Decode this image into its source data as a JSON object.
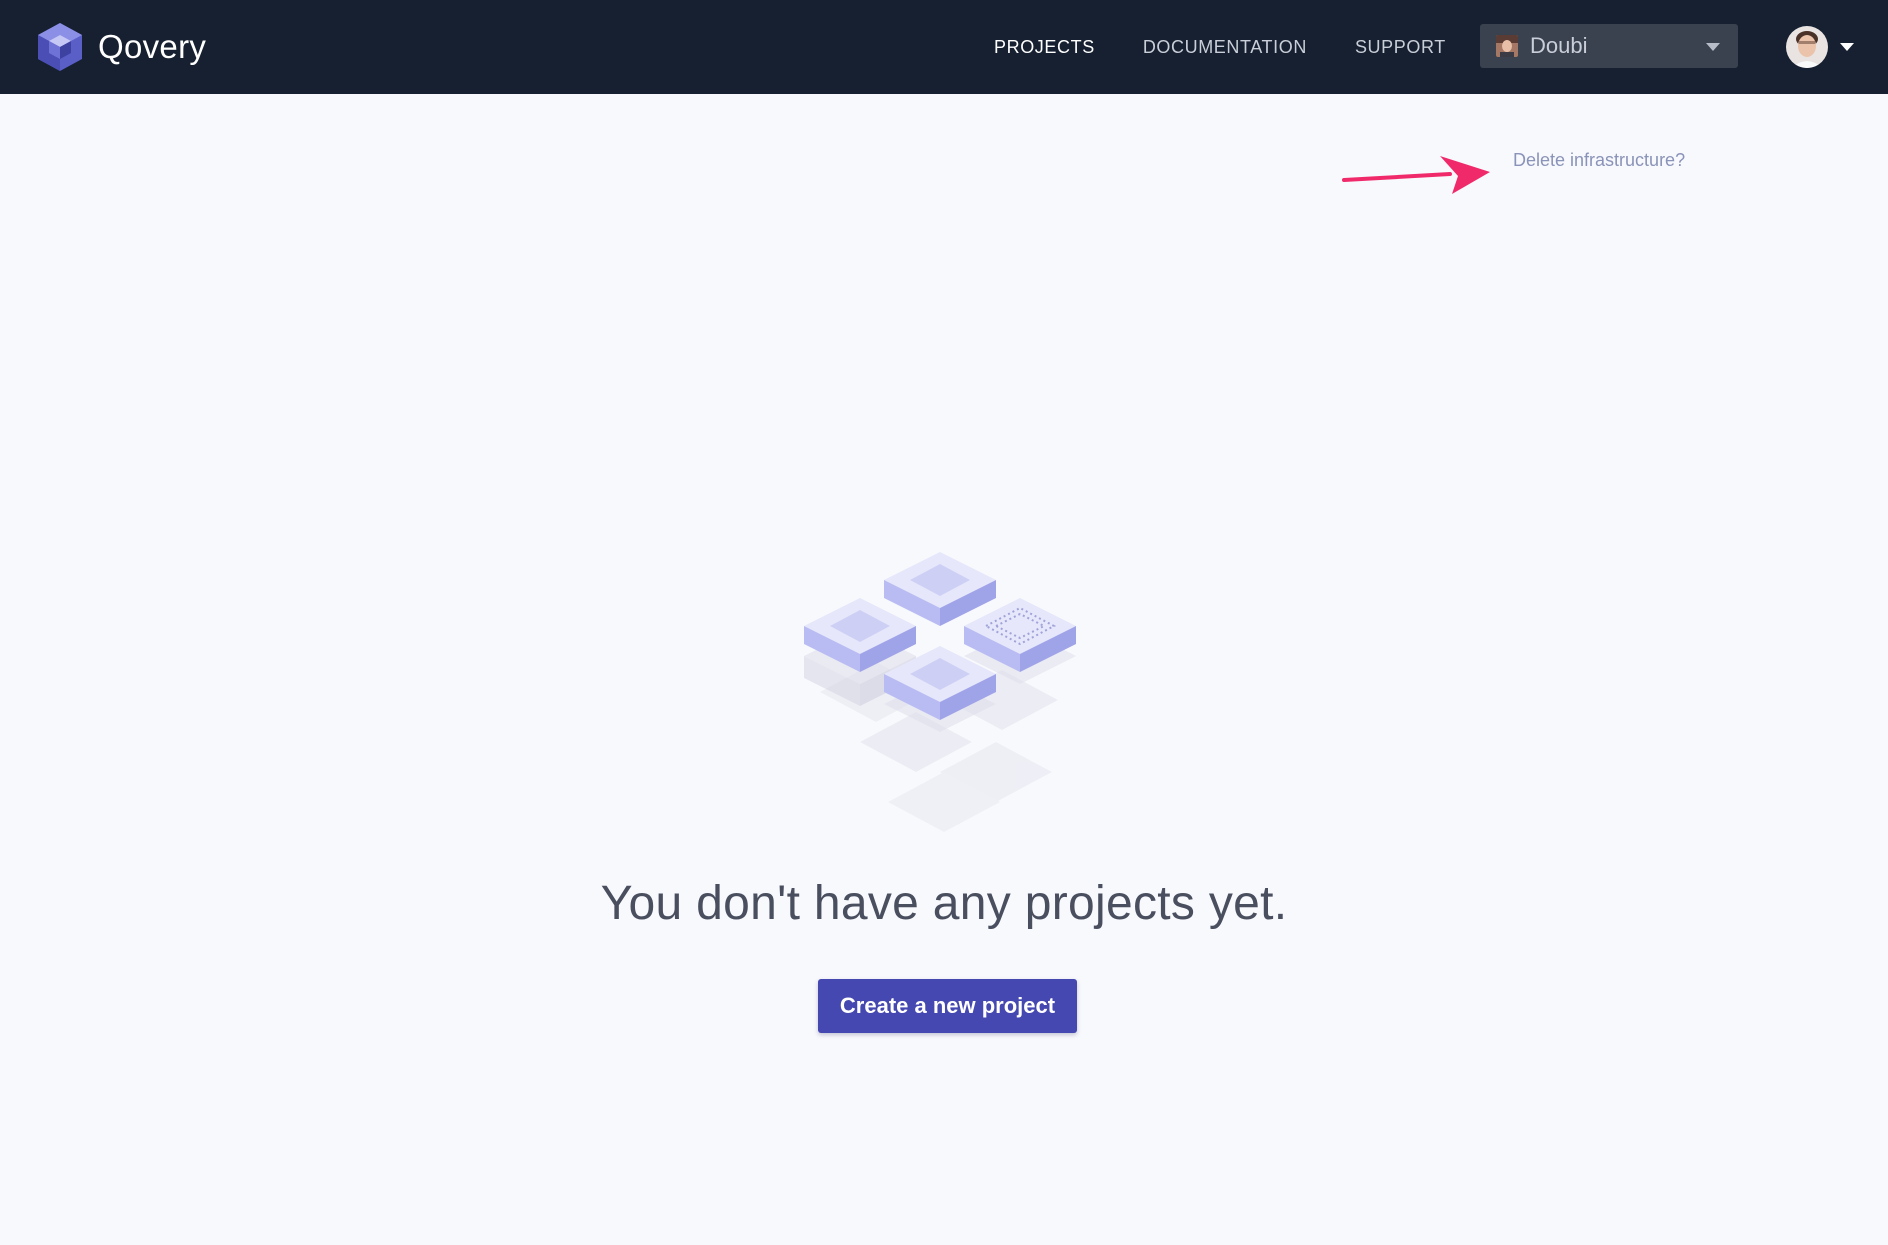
{
  "navbar": {
    "brand_name": "Qovery",
    "links": {
      "projects": "PROJECTS",
      "documentation": "DOCUMENTATION",
      "support": "SUPPORT"
    },
    "organization": {
      "selected": "Doubi"
    }
  },
  "main": {
    "delete_link": "Delete infrastructure?",
    "empty_message": "You don't have any projects yet.",
    "create_button": "Create a new project"
  },
  "colors": {
    "navbar_bg": "#162030",
    "page_bg": "#f8f9fd",
    "accent": "#4548b0",
    "annotation_arrow": "#f02a6a",
    "link_muted": "#8a93b8"
  },
  "icons": {
    "brand": "qovery-cube-logo",
    "org_avatar": "org-avatar",
    "user_avatar": "user-avatar",
    "caret": "chevron-down-icon",
    "annotation": "arrow-right-icon",
    "illustration": "isometric-blocks-illustration"
  }
}
